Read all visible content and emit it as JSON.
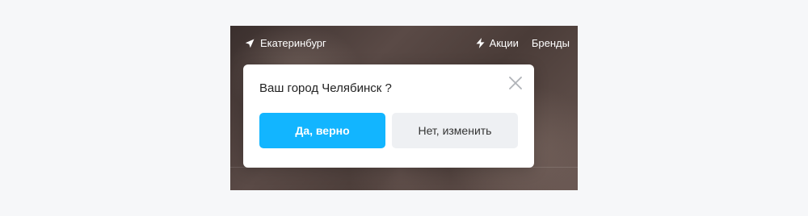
{
  "header": {
    "city": "Екатеринбург",
    "city_icon": "location-arrow-icon",
    "nav": [
      {
        "label": "Акции",
        "icon": "lightning-icon"
      },
      {
        "label": "Бренды"
      }
    ]
  },
  "dialog": {
    "title": "Ваш город Челябинск ?",
    "confirm_label": "Да, верно",
    "change_label": "Нет, изменить",
    "close_icon": "close-icon"
  },
  "colors": {
    "accent": "#12b5ff",
    "secondary_button": "#eef0f3"
  }
}
